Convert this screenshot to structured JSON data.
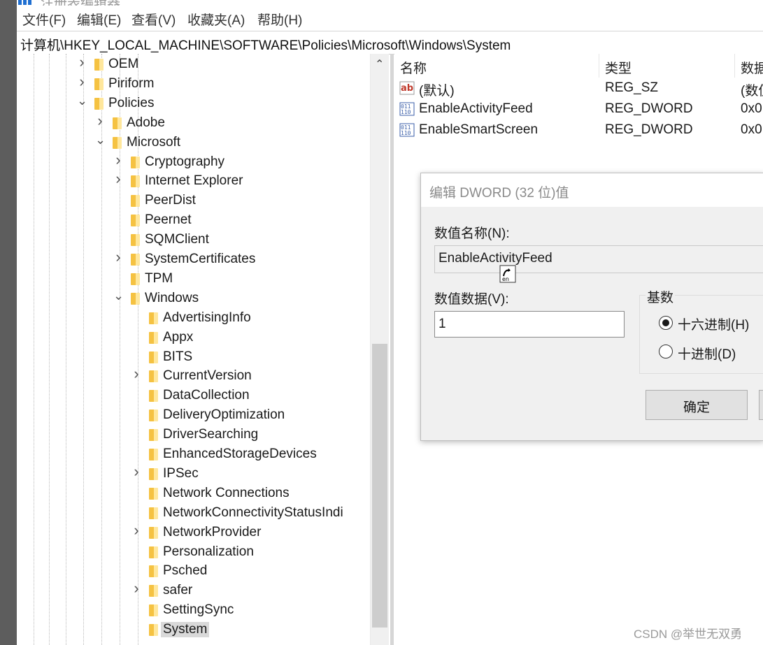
{
  "window": {
    "title": "注册表编辑器",
    "accent": "#1f6fd1"
  },
  "menu": [
    "文件(F)",
    "编辑(E)",
    "查看(V)",
    "收藏夹(A)",
    "帮助(H)"
  ],
  "address": "计算机\\HKEY_LOCAL_MACHINE\\SOFTWARE\\Policies\\Microsoft\\Windows\\System",
  "tree": [
    {
      "label": "OEM",
      "level": 0,
      "expander": "collapsed"
    },
    {
      "label": "Piriform",
      "level": 0,
      "expander": "collapsed"
    },
    {
      "label": "Policies",
      "level": 0,
      "expander": "expanded"
    },
    {
      "label": "Adobe",
      "level": 1,
      "expander": "collapsed"
    },
    {
      "label": "Microsoft",
      "level": 1,
      "expander": "expanded"
    },
    {
      "label": "Cryptography",
      "level": 2,
      "expander": "collapsed"
    },
    {
      "label": "Internet Explorer",
      "level": 2,
      "expander": "collapsed"
    },
    {
      "label": "PeerDist",
      "level": 2,
      "expander": "none"
    },
    {
      "label": "Peernet",
      "level": 2,
      "expander": "none"
    },
    {
      "label": "SQMClient",
      "level": 2,
      "expander": "none"
    },
    {
      "label": "SystemCertificates",
      "level": 2,
      "expander": "collapsed"
    },
    {
      "label": "TPM",
      "level": 2,
      "expander": "none"
    },
    {
      "label": "Windows",
      "level": 2,
      "expander": "expanded"
    },
    {
      "label": "AdvertisingInfo",
      "level": 3,
      "expander": "none"
    },
    {
      "label": "Appx",
      "level": 3,
      "expander": "none"
    },
    {
      "label": "BITS",
      "level": 3,
      "expander": "none"
    },
    {
      "label": "CurrentVersion",
      "level": 3,
      "expander": "collapsed"
    },
    {
      "label": "DataCollection",
      "level": 3,
      "expander": "none"
    },
    {
      "label": "DeliveryOptimization",
      "level": 3,
      "expander": "none"
    },
    {
      "label": "DriverSearching",
      "level": 3,
      "expander": "none"
    },
    {
      "label": "EnhancedStorageDevices",
      "level": 3,
      "expander": "none"
    },
    {
      "label": "IPSec",
      "level": 3,
      "expander": "collapsed"
    },
    {
      "label": "Network Connections",
      "level": 3,
      "expander": "none"
    },
    {
      "label": "NetworkConnectivityStatusIndi",
      "level": 3,
      "expander": "none"
    },
    {
      "label": "NetworkProvider",
      "level": 3,
      "expander": "collapsed"
    },
    {
      "label": "Personalization",
      "level": 3,
      "expander": "none"
    },
    {
      "label": "Psched",
      "level": 3,
      "expander": "none"
    },
    {
      "label": "safer",
      "level": 3,
      "expander": "collapsed"
    },
    {
      "label": "SettingSync",
      "level": 3,
      "expander": "none"
    },
    {
      "label": "System",
      "level": 3,
      "expander": "none",
      "selected": true
    }
  ],
  "list": {
    "columns": [
      "名称",
      "类型",
      "数据"
    ],
    "rows": [
      {
        "icon": "string-value-icon",
        "name": "(默认)",
        "type": "REG_SZ",
        "data": "(数值"
      },
      {
        "icon": "dword-value-icon",
        "name": "EnableActivityFeed",
        "type": "REG_DWORD",
        "data": "0x0"
      },
      {
        "icon": "dword-value-icon",
        "name": "EnableSmartScreen",
        "type": "REG_DWORD",
        "data": "0x0"
      }
    ]
  },
  "dialog": {
    "title": "编辑 DWORD (32 位)值",
    "name_label": "数值名称(N):",
    "name_value": "EnableActivityFeed",
    "data_label": "数值数据(V):",
    "data_value": "1",
    "base_label": "基数",
    "hex_label": "十六进制(H)",
    "dec_label": "十进制(D)",
    "selected_base": "hex",
    "ok_label": "确定"
  },
  "watermark": "CSDN @举世无双勇"
}
